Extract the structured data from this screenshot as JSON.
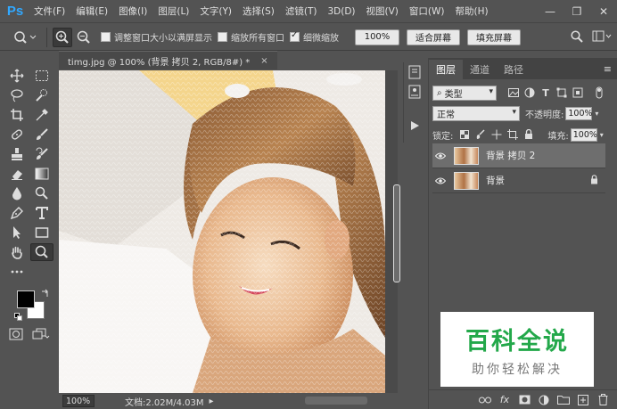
{
  "app": {
    "logo": "Ps"
  },
  "menu": [
    "文件(F)",
    "编辑(E)",
    "图像(I)",
    "图层(L)",
    "文字(Y)",
    "选择(S)",
    "滤镜(T)",
    "3D(D)",
    "视图(V)",
    "窗口(W)",
    "帮助(H)"
  ],
  "window_controls": {
    "minimize": "—",
    "restore": "❐",
    "close": "✕"
  },
  "options": {
    "resize_windows_label": "调整窗口大小以满屏显示",
    "zoom_all_windows_label": "缩放所有窗口",
    "scrubby_zoom_label": "细微缩放",
    "scrubby_zoom_checked": true,
    "resize_checked": false,
    "zoom_all_checked": false,
    "zoom_percent_btn": "100%",
    "fit_screen_btn": "适合屏幕",
    "fill_screen_btn": "填充屏幕"
  },
  "document": {
    "tab_title": "timg.jpg @ 100% (背景 拷贝 2, RGB/8#) *",
    "close": "×",
    "zoom": "100%",
    "doc_info": "文档:2.02M/4.03M",
    "status_arrow": "▸"
  },
  "panel": {
    "tabs": [
      "图层",
      "通道",
      "路径"
    ],
    "active_tab": 0,
    "menu": "≡",
    "filter_kind": "类型",
    "blend_mode": "正常",
    "opacity_label": "不透明度:",
    "opacity_value": "100%",
    "lock_label": "锁定:",
    "fill_label": "填充:",
    "fill_value": "100%",
    "layers": [
      {
        "name": "背景 拷贝 2",
        "selected": true,
        "locked": false
      },
      {
        "name": "背景",
        "selected": false,
        "locked": true
      }
    ],
    "bottom_icons": [
      "link-icon",
      "fx-icon",
      "mask-icon",
      "adjustment-icon",
      "group-icon",
      "new-layer-icon",
      "trash-icon"
    ],
    "fx_label": "fx"
  },
  "watermark": {
    "title": "百科全说",
    "subtitle": "助你轻松解决"
  },
  "colors": {
    "accent": "#31a8ff",
    "brand_green": "#23a84a",
    "ui_bg": "#535353"
  }
}
